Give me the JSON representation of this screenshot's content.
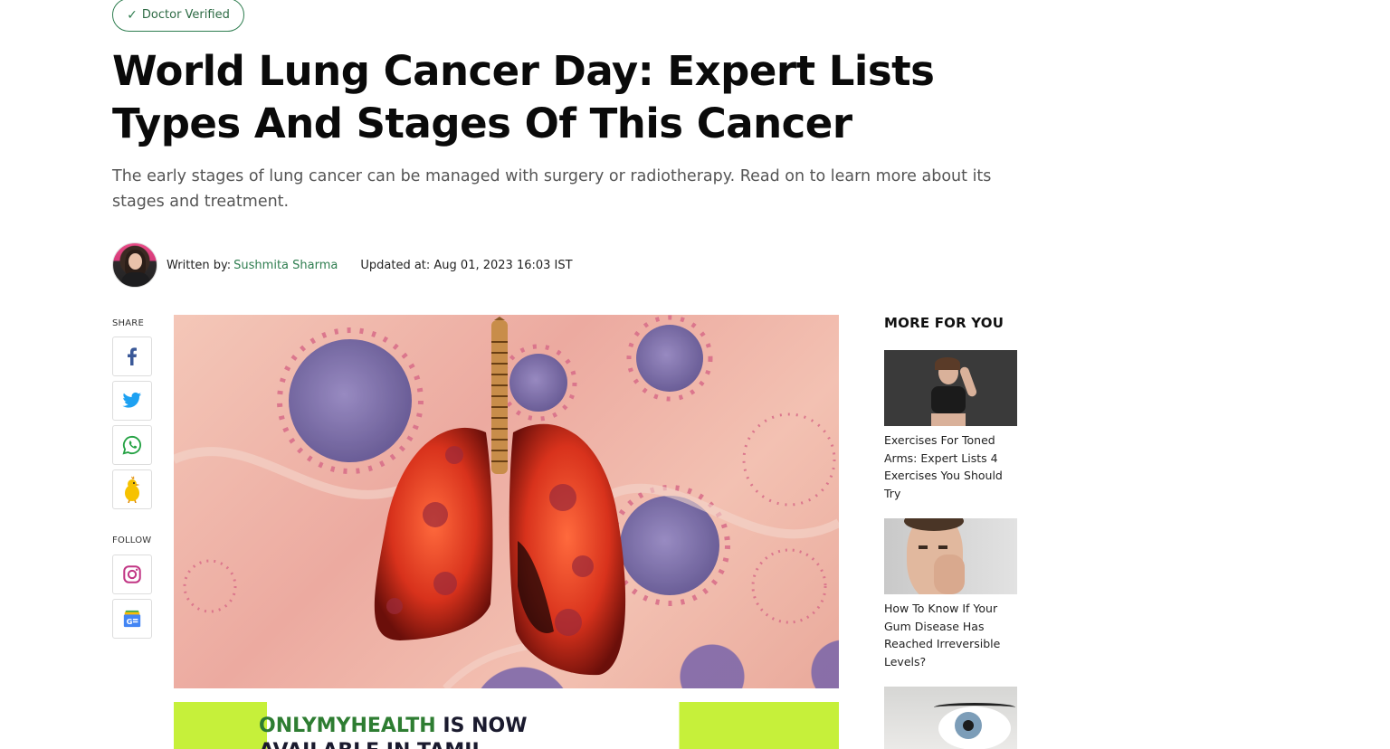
{
  "badge": {
    "label": "Doctor Verified",
    "icon": "check-icon"
  },
  "article": {
    "title": "World Lung Cancer Day: Expert Lists Types And Stages Of This Cancer",
    "summary": "The early stages of lung cancer can be managed with surgery or radiotherapy. Read on to learn more about its stages and treatment.",
    "written_by_label": "Written by:",
    "author": "Sushmita Sharma",
    "updated": "Updated at: Aug 01, 2023 16:03 IST"
  },
  "share": {
    "label": "SHARE",
    "items": [
      {
        "name": "facebook",
        "icon": "facebook-icon",
        "color": "#3b5998"
      },
      {
        "name": "twitter",
        "icon": "twitter-icon",
        "color": "#1da1f2"
      },
      {
        "name": "whatsapp",
        "icon": "whatsapp-icon",
        "color": "#25a244"
      },
      {
        "name": "koo",
        "icon": "koo-icon",
        "color": "#f6c200"
      }
    ]
  },
  "follow": {
    "label": "FOLLOW",
    "items": [
      {
        "name": "instagram",
        "icon": "instagram-icon",
        "color": "#c13584"
      },
      {
        "name": "google-news",
        "icon": "google-news-icon",
        "color": "#4285f4"
      }
    ]
  },
  "promo": {
    "brand": "ONLYMYHEALTH",
    "rest": " IS NOW",
    "line2": "AVAILABLE IN TAMIL"
  },
  "sidebar": {
    "heading": "MORE FOR YOU",
    "cards": [
      {
        "title": "Exercises For Toned Arms: Expert Lists 4 Exercises You Should Try"
      },
      {
        "title": "How To Know If Your Gum Disease Has Reached Irreversible Levels?"
      },
      {
        "title": ""
      }
    ]
  },
  "colors": {
    "accent": "#2e7d4f",
    "promo_green": "#c6f03a"
  }
}
